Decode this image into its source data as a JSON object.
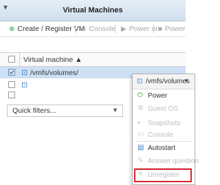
{
  "panel": {
    "title": "Virtual Machines",
    "collapse_icon": "triangle-down-icon"
  },
  "toolbar": {
    "create_label": "Create / Register VM",
    "console_label": "Console",
    "power_on_label": "Power on",
    "power_off_label": "Power"
  },
  "grid": {
    "column_header": "Virtual machine ▲",
    "rows": [
      {
        "name": "/vmfs/volumes/",
        "selected": true
      },
      {
        "name": "",
        "selected": false
      },
      {
        "name": "",
        "selected": false
      }
    ]
  },
  "filter": {
    "placeholder": "Quick filters..."
  },
  "context_menu": {
    "header": "/vmfs/volumes",
    "items": [
      {
        "label": "Power",
        "enabled": true
      },
      {
        "label": "Guest OS",
        "enabled": false
      },
      {
        "label": "Snapshots",
        "enabled": false
      },
      {
        "label": "Console",
        "enabled": false
      },
      {
        "label": "Autostart",
        "enabled": true
      },
      {
        "label": "Answer question",
        "enabled": false
      },
      {
        "label": "Unregister",
        "enabled": false
      }
    ]
  },
  "colors": {
    "header_gradient_top": "#e6eff8",
    "header_gradient_bottom": "#cfdeed",
    "selected_row": "#cde0f4",
    "highlight_outline": "#d9232e",
    "power_icon": "#2e9e3f",
    "vm_icon": "#3c7fc4"
  }
}
